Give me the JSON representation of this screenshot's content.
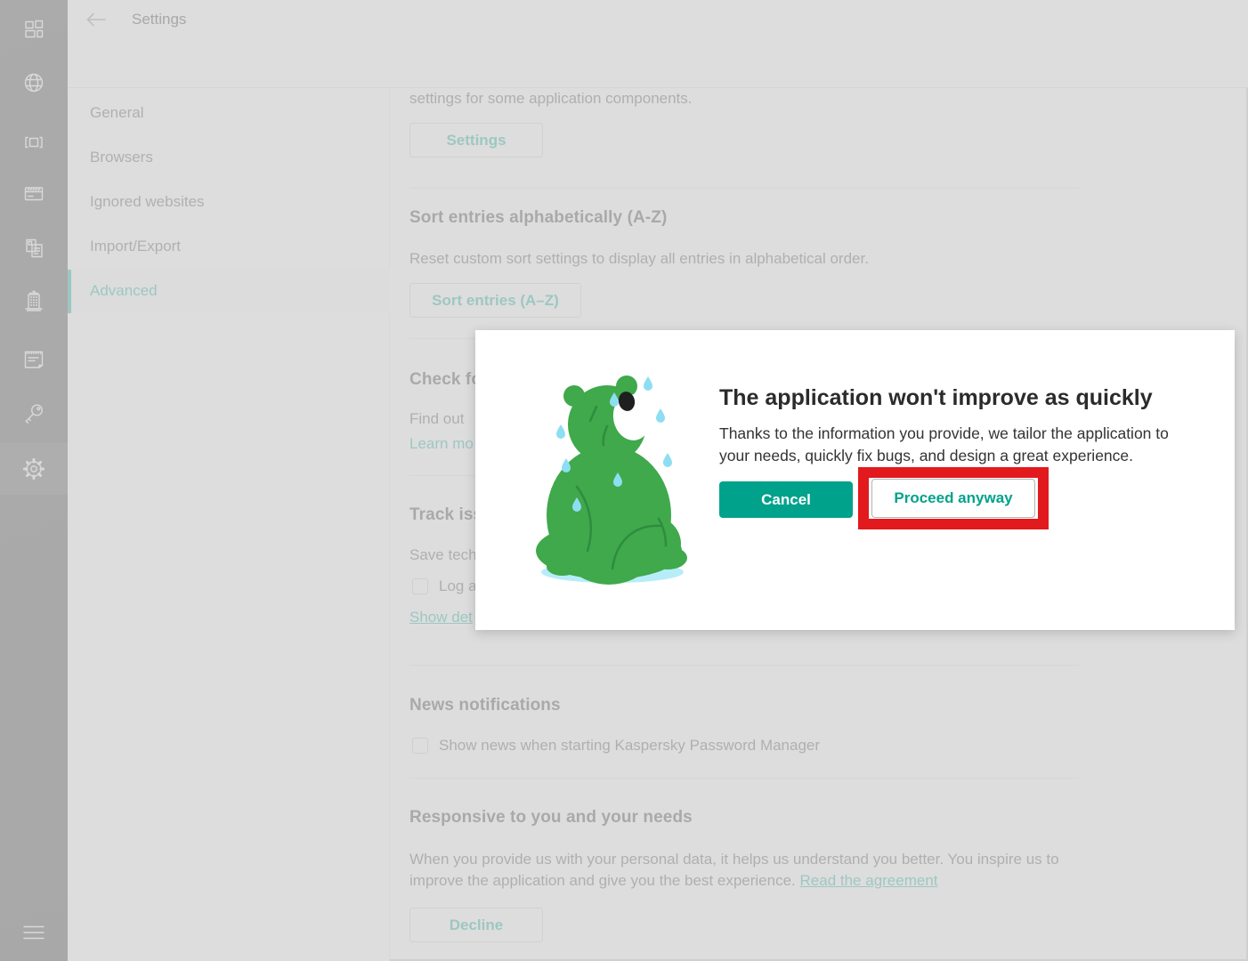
{
  "colors": {
    "accent": "#00a88e",
    "annotation_red": "#e2191d",
    "cancel_bg": "#00a28c",
    "bear_green": "#3fa94b"
  },
  "header": {
    "title": "Settings",
    "back_icon": "left-arrow-icon"
  },
  "sidebar": {
    "icons": [
      "all-items-icon",
      "websites-icon",
      "applications-icon",
      "bank-cards-icon",
      "documents-icon",
      "addresses-icon",
      "notes-icon",
      "passwords-icon",
      "settings-gear-icon",
      "menu-icon"
    ]
  },
  "nav": {
    "items": [
      {
        "label": "General",
        "active": false
      },
      {
        "label": "Browsers",
        "active": false
      },
      {
        "label": "Ignored websites",
        "active": false
      },
      {
        "label": "Import/Export",
        "active": false
      },
      {
        "label": "Advanced",
        "active": true
      }
    ]
  },
  "content": {
    "intro_fragment": "settings for some application components.",
    "settings_button": "Settings",
    "sort": {
      "heading": "Sort entries alphabetically (A-Z)",
      "body": "Reset custom sort settings to display all entries in alphabetical order.",
      "button": "Sort entries (A–Z)"
    },
    "check_section_fragment": {
      "heading": "Check fo",
      "line": "Find out",
      "link": "Learn mo"
    },
    "track_section_fragment": {
      "heading": "Track iss",
      "line": "Save tech",
      "checkbox_label": "Log a",
      "link": "Show det"
    },
    "news": {
      "heading": "News notifications",
      "checkbox_label": "Show news when starting Kaspersky Password Manager",
      "checkbox_checked": false
    },
    "responsive": {
      "heading": "Responsive to you and your needs",
      "body": "When you provide us with your personal data, it helps us understand you better. You inspire us to improve the application and give you the best experience.",
      "link": "Read the agreement",
      "button": "Decline"
    }
  },
  "modal": {
    "illustration": "sad-bear",
    "title": "The application won't improve as quickly",
    "body": "Thanks to the information you provide, we tailor the application to your needs, quickly fix bugs, and design a great experience.",
    "cancel_button": "Cancel",
    "proceed_button": "Proceed anyway",
    "annotation": "red-highlight-box"
  }
}
